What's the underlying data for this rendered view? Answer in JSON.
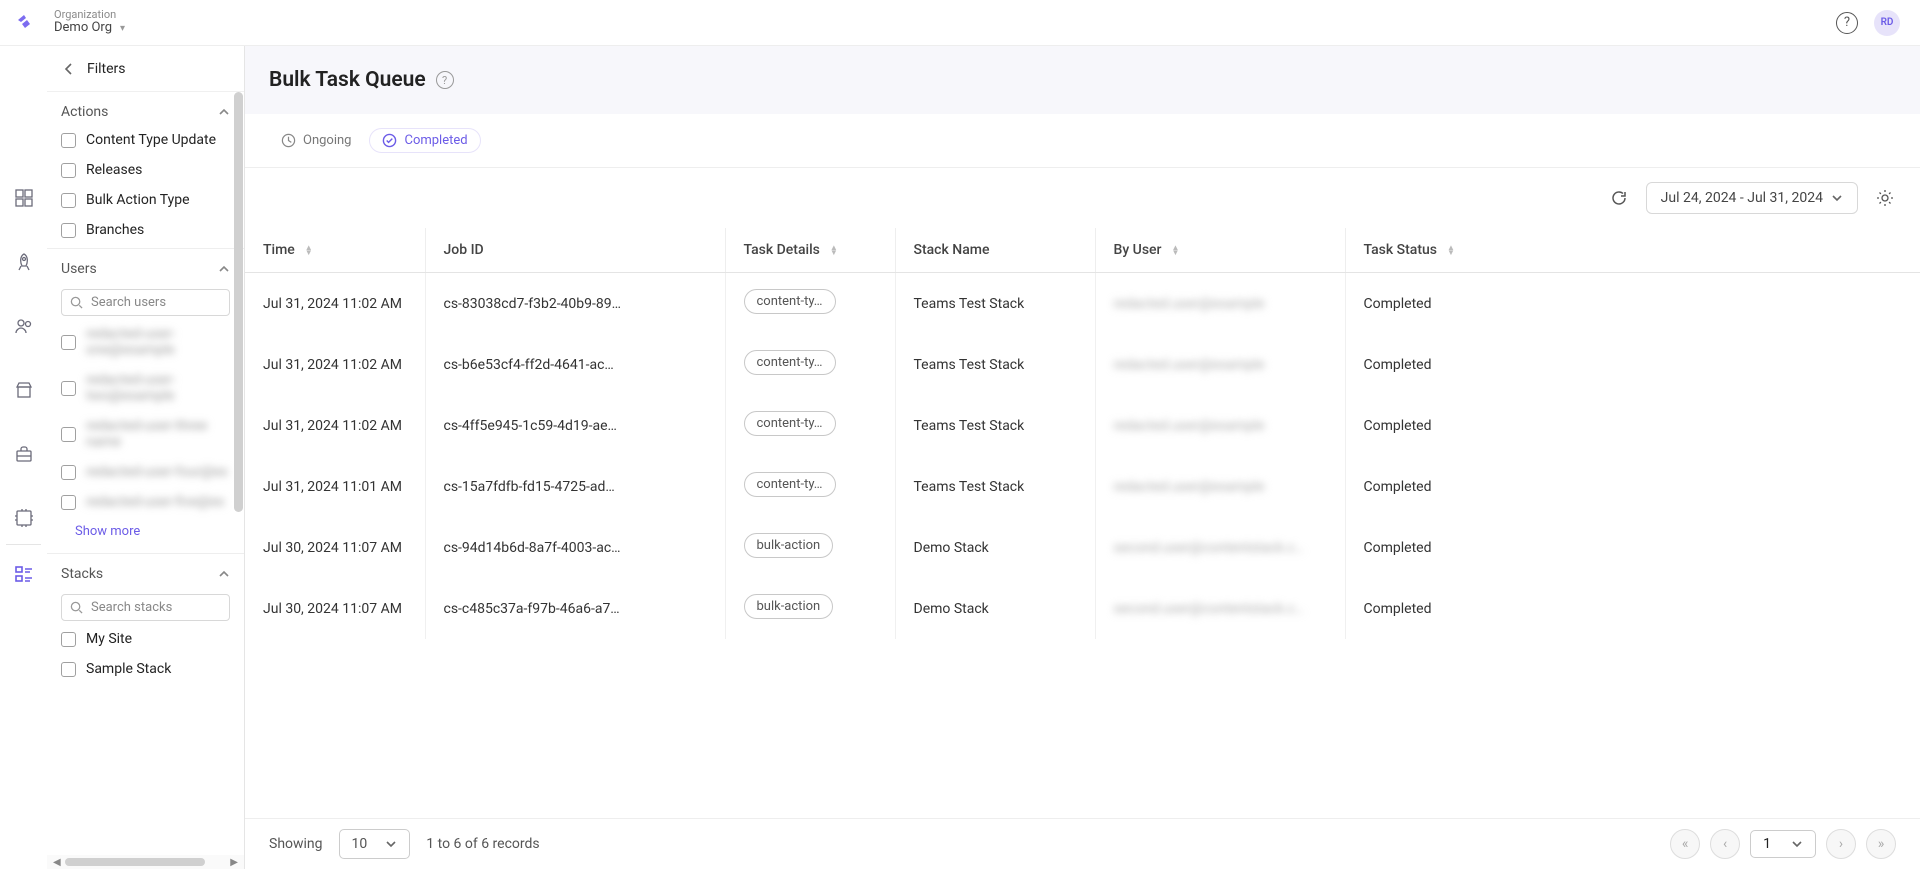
{
  "header": {
    "org_label": "Organization",
    "org_name": "Demo Org",
    "avatar": "RD"
  },
  "filters": {
    "title": "Filters",
    "sections": {
      "actions": {
        "title": "Actions",
        "items": [
          "Content Type Update",
          "Releases",
          "Bulk Action Type",
          "Branches"
        ]
      },
      "users": {
        "title": "Users",
        "search_placeholder": "Search users",
        "items": [
          "redacted-user-one@example",
          "redacted-user-two@example",
          "redacted-user-three name",
          "redacted-user-four@ex",
          "redacted-user-five@ex"
        ],
        "show_more": "Show more"
      },
      "stacks": {
        "title": "Stacks",
        "search_placeholder": "Search stacks",
        "items": [
          "My Site",
          "Sample Stack"
        ]
      }
    }
  },
  "page": {
    "title": "Bulk Task Queue"
  },
  "tabs": {
    "ongoing": "Ongoing",
    "completed": "Completed"
  },
  "toolbar": {
    "date_range": "Jul 24, 2024 - Jul 31, 2024"
  },
  "table": {
    "columns": {
      "time": "Time",
      "job_id": "Job ID",
      "task_details": "Task Details",
      "stack_name": "Stack Name",
      "by_user": "By User",
      "task_status": "Task Status"
    },
    "rows": [
      {
        "time": "Jul 31, 2024 11:02 AM",
        "job_id": "cs-83038cd7-f3b2-40b9-89…",
        "task_details": "content-ty…",
        "stack_name": "Teams Test Stack",
        "by_user": "redacted.user@example",
        "status": "Completed"
      },
      {
        "time": "Jul 31, 2024 11:02 AM",
        "job_id": "cs-b6e53cf4-ff2d-4641-ac…",
        "task_details": "content-ty…",
        "stack_name": "Teams Test Stack",
        "by_user": "redacted.user@example",
        "status": "Completed"
      },
      {
        "time": "Jul 31, 2024 11:02 AM",
        "job_id": "cs-4ff5e945-1c59-4d19-ae…",
        "task_details": "content-ty…",
        "stack_name": "Teams Test Stack",
        "by_user": "redacted.user@example",
        "status": "Completed"
      },
      {
        "time": "Jul 31, 2024 11:01 AM",
        "job_id": "cs-15a7fdfb-fd15-4725-ad…",
        "task_details": "content-ty…",
        "stack_name": "Teams Test Stack",
        "by_user": "redacted.user@example",
        "status": "Completed"
      },
      {
        "time": "Jul 30, 2024 11:07 AM",
        "job_id": "cs-94d14b6d-8a7f-4003-ac…",
        "task_details": "bulk-action",
        "stack_name": "Demo Stack",
        "by_user": "second.user@contentstack.c…",
        "status": "Completed"
      },
      {
        "time": "Jul 30, 2024 11:07 AM",
        "job_id": "cs-c485c37a-f97b-46a6-a7…",
        "task_details": "bulk-action",
        "stack_name": "Demo Stack",
        "by_user": "second.user@contentstack.c…",
        "status": "Completed"
      }
    ]
  },
  "footer": {
    "showing": "Showing",
    "page_size": "10",
    "records": "1 to 6 of 6 records",
    "page_num": "1"
  }
}
